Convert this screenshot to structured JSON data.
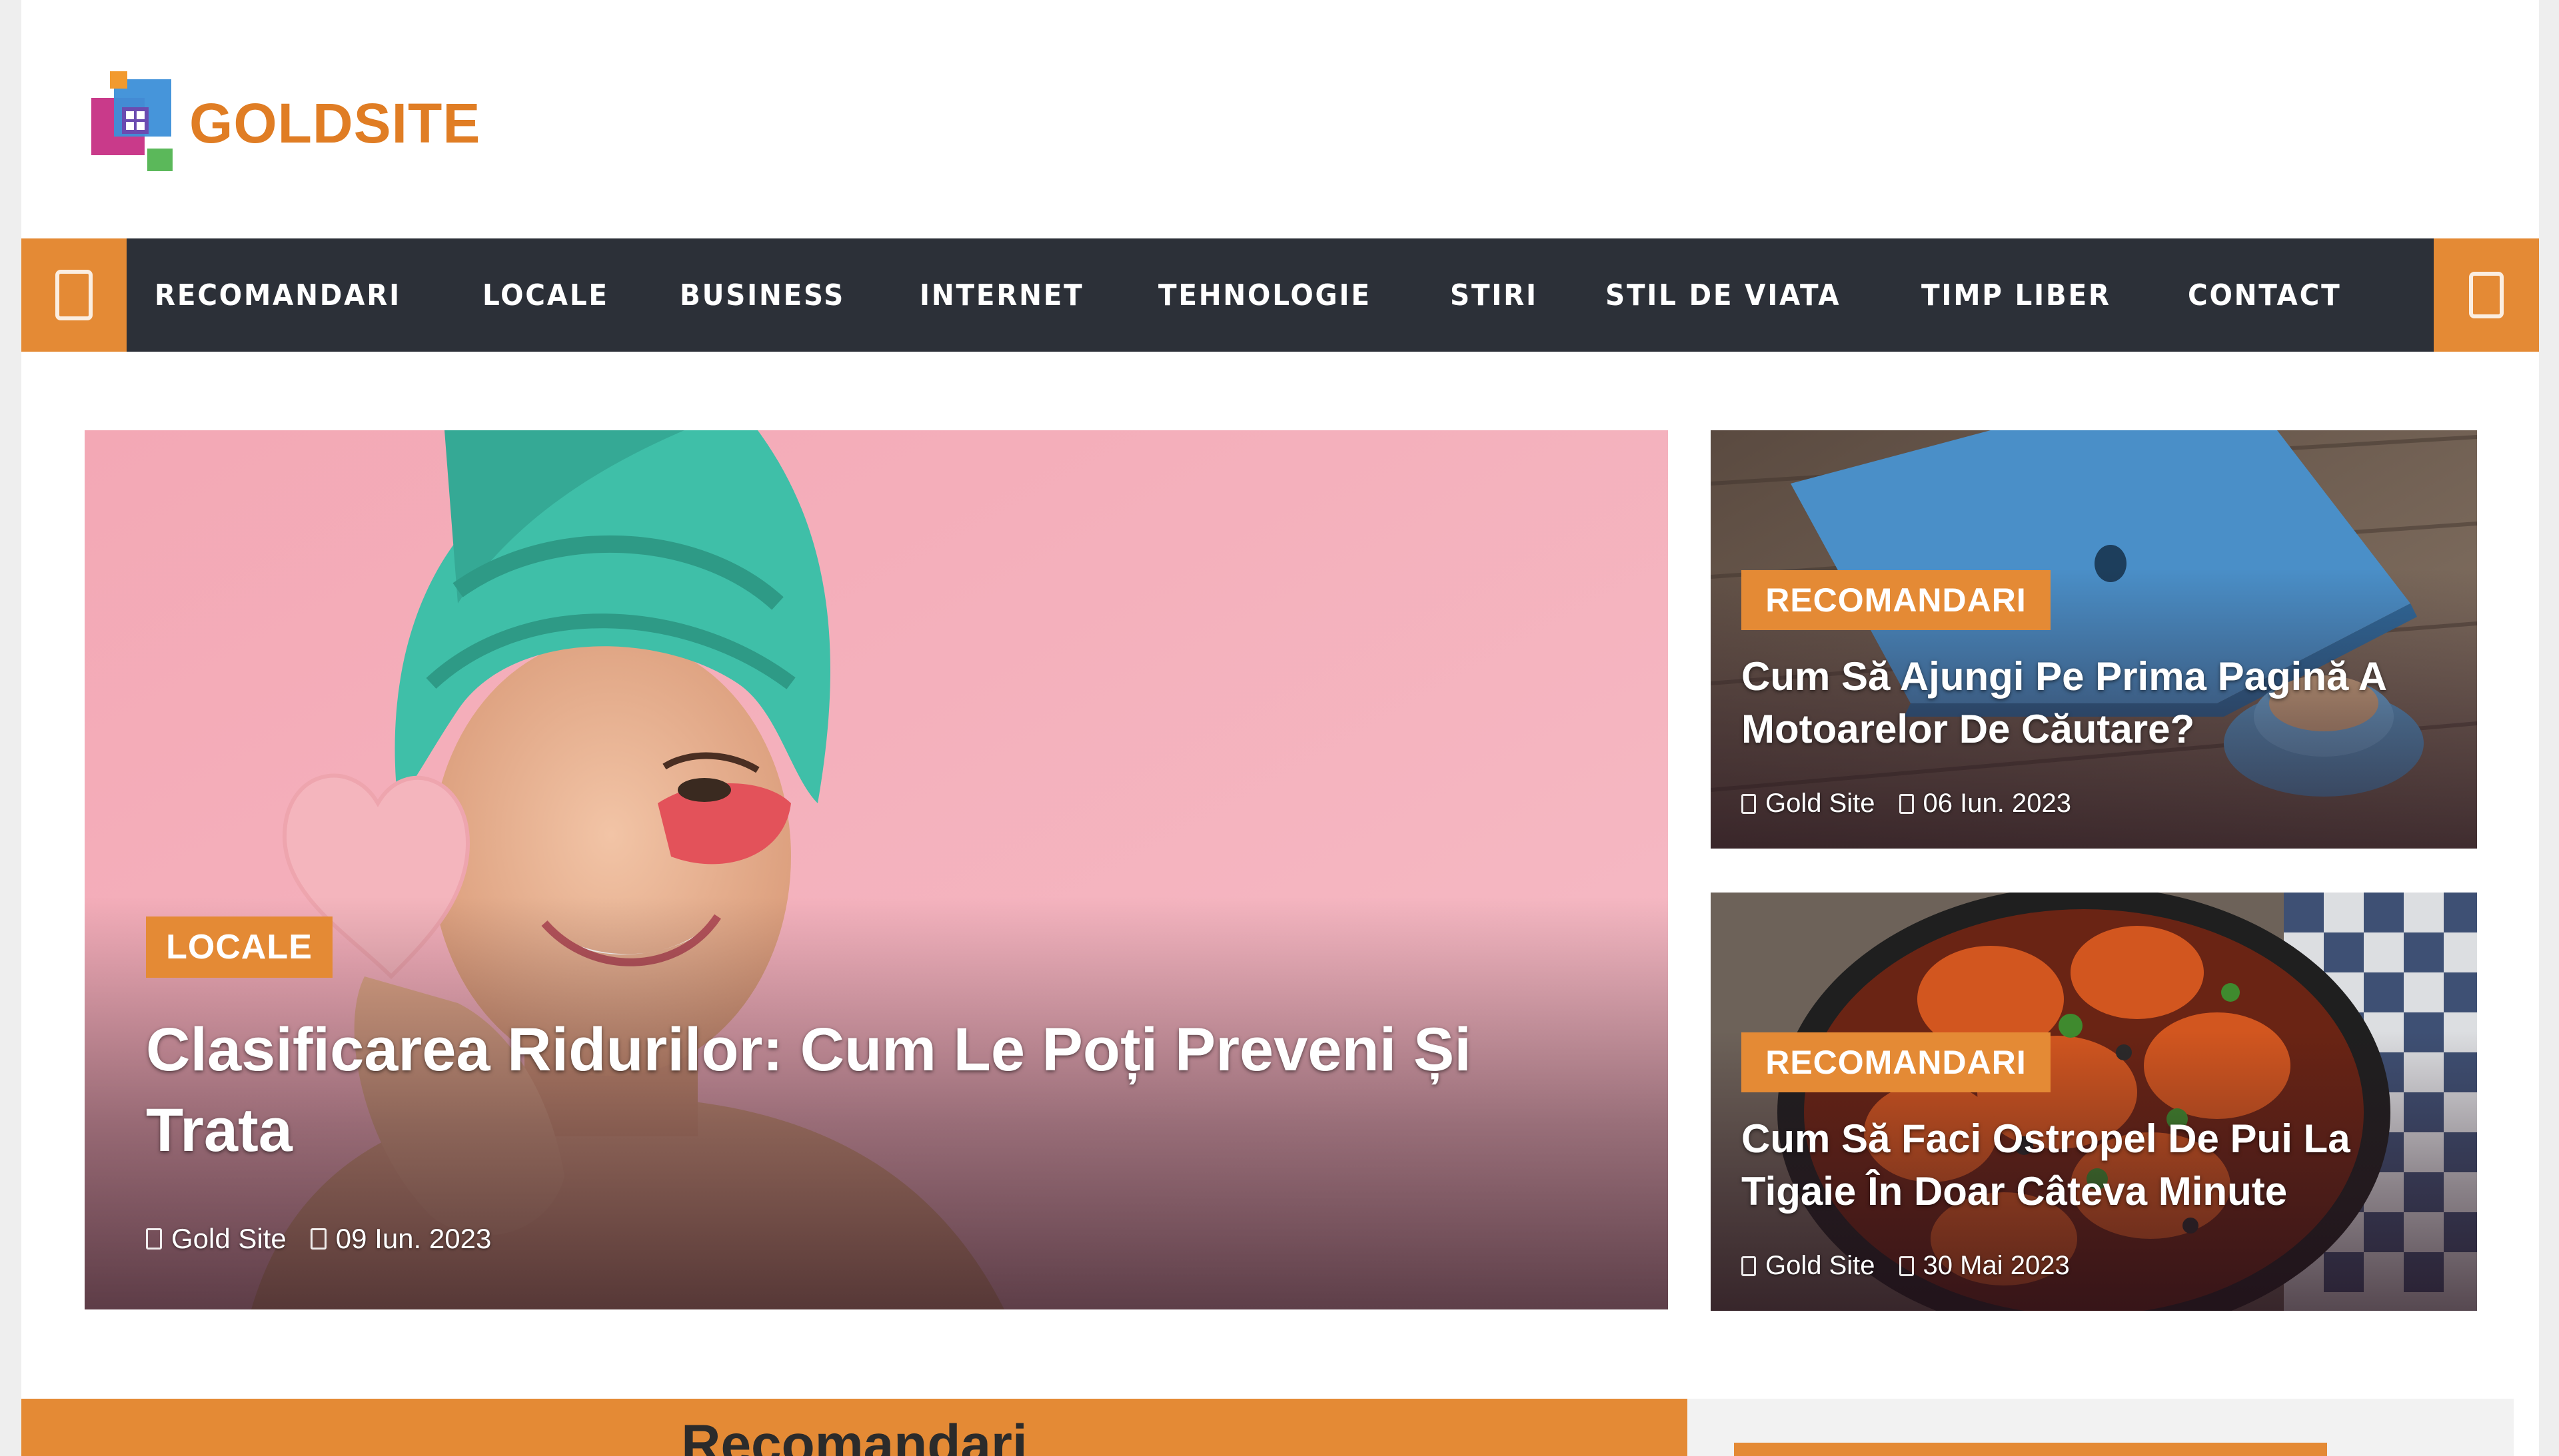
{
  "brand": {
    "name": "GOLDSITE",
    "color": "#e07d24"
  },
  "theme": {
    "accent": "#e48a35",
    "nav_bg": "#2c3038"
  },
  "nav": {
    "items": [
      {
        "label": "RECOMANDARI"
      },
      {
        "label": "LOCALE"
      },
      {
        "label": "BUSINESS"
      },
      {
        "label": "INTERNET"
      },
      {
        "label": "TEHNOLOGIE"
      },
      {
        "label": "STIRI"
      },
      {
        "label": "STIL DE VIATA"
      },
      {
        "label": "TIMP LIBER"
      },
      {
        "label": "CONTACT"
      }
    ],
    "left_icon": "menu-box-icon",
    "right_icon": "search-box-icon"
  },
  "featured": {
    "category": "LOCALE",
    "title": "Clasificarea Ridurilor: Cum Le Poți Preveni Și Trata",
    "author": "Gold Site",
    "date": "09 Iun. 2023",
    "image": "woman-towel-heart-sponge"
  },
  "side_posts": [
    {
      "category": "RECOMANDARI",
      "title": "Cum Să Ajungi Pe Prima Pagină A Motoarelor De Căutare?",
      "author": "Gold Site",
      "date": "06 Iun. 2023",
      "image": "laptop-coffee"
    },
    {
      "category": "RECOMANDARI",
      "title": "Cum Să Faci Ostropel De Pui La Tigaie În Doar Câteva Minute",
      "author": "Gold Site",
      "date": "30 Mai 2023",
      "image": "chicken-pan"
    }
  ],
  "section": {
    "title": "Recomandari"
  }
}
